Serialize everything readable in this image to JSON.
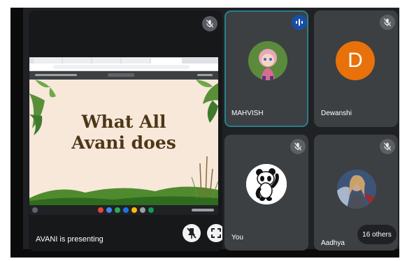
{
  "presentation": {
    "presenter_label": "AVANI is presenting",
    "slide_title_line1": "What All",
    "slide_title_line2": "Avani does"
  },
  "participants": [
    {
      "name": "MAHVISH",
      "speaking": true,
      "avatar": "masha-cartoon-photo"
    },
    {
      "name": "Dewanshi",
      "muted": true,
      "avatar_letter": "D",
      "avatar_color": "#e8710a"
    },
    {
      "name": "You",
      "muted": true,
      "avatar": "panda-cartoon-photo"
    },
    {
      "name": "Aadhya",
      "muted": true,
      "avatar": "thor-photo"
    }
  ],
  "others_count_label": "16 others",
  "colors": {
    "background": "#202124",
    "tile": "#3c4043",
    "speaking_border": "#2a7e8a",
    "speaking_badge": "#174ea6",
    "slide_bg": "#f7e8da",
    "slide_text": "#4e3717"
  },
  "icons": [
    "mic-off-icon",
    "audio-wave-icon",
    "pin-off-icon",
    "fullscreen-icon"
  ]
}
